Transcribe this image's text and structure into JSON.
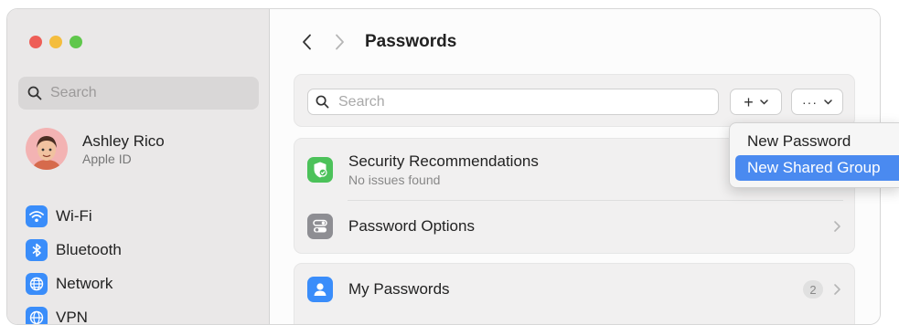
{
  "sidebar": {
    "search_placeholder": "Search",
    "user": {
      "name": "Ashley Rico",
      "subtitle": "Apple ID"
    },
    "items": [
      {
        "label": "Wi-Fi",
        "icon": "wifi-icon"
      },
      {
        "label": "Bluetooth",
        "icon": "bluetooth-icon"
      },
      {
        "label": "Network",
        "icon": "globe-icon"
      },
      {
        "label": "VPN",
        "icon": "vpn-icon"
      }
    ]
  },
  "header": {
    "title": "Passwords"
  },
  "toolbar": {
    "search_placeholder": "Search",
    "add_glyph": "+",
    "more_glyph": "···"
  },
  "rows": {
    "security": {
      "title": "Security Recommendations",
      "subtitle": "No issues found"
    },
    "options": {
      "title": "Password Options"
    },
    "my_passwords": {
      "title": "My Passwords",
      "count": "2"
    }
  },
  "menu": {
    "items": [
      {
        "label": "New Password"
      },
      {
        "label": "New Shared Group"
      }
    ]
  },
  "colors": {
    "accent": "#3a8dfa",
    "menu_highlight": "#4a8af0",
    "security_green": "#4cc25a",
    "options_gray": "#8e8e93"
  }
}
